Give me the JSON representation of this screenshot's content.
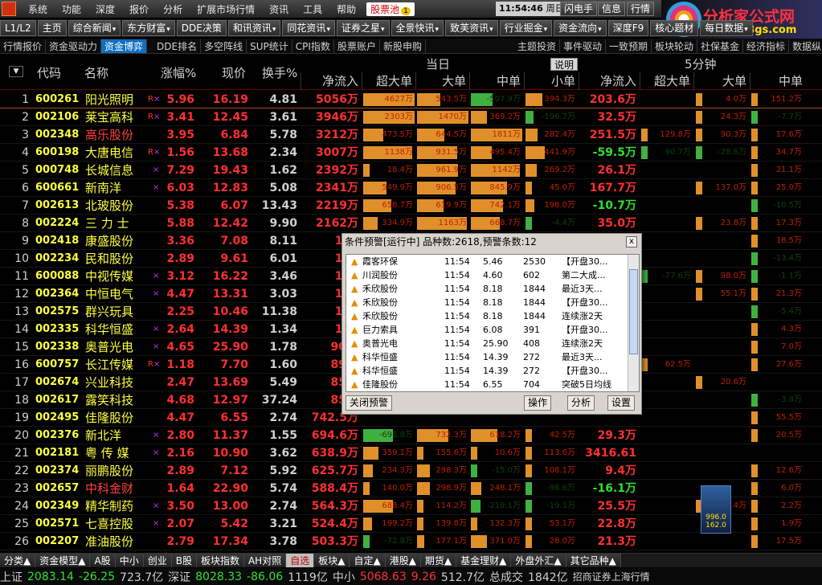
{
  "menu": [
    "系统",
    "功能",
    "深度",
    "报价",
    "分析",
    "扩展市场行情",
    "资讯",
    "工具",
    "帮助"
  ],
  "hot_menu": {
    "label": "股票池",
    "badge": "1"
  },
  "clock": {
    "time": "11:54:46",
    "day": "周日"
  },
  "top_buttons": [
    "闪电手",
    "信息",
    "行情"
  ],
  "logo": {
    "title": "分析家公式网",
    "url": "www.88gs.com"
  },
  "toolbar": [
    "L1/L2",
    "主页",
    "综合新闻",
    "东方财富",
    "DDE决策",
    "和讯资讯",
    "同花资讯",
    "证券之星",
    "全景快讯",
    "致芙资讯",
    "行业掘金",
    "资金流向",
    "深度F9",
    "核心题材",
    "每日数据"
  ],
  "tabs2": [
    "行情报价",
    "资金驱动力",
    "资金博弈",
    "DDE排名",
    "多空阵线",
    "SUP统计",
    "CPI指数",
    "股票账户",
    "新股申购"
  ],
  "tabs2_right": [
    "主题投资",
    "事件驱动",
    "一致预期",
    "板块轮动",
    "社保基金",
    "经济指标",
    "数据纵览"
  ],
  "header": {
    "code": "代码",
    "name": "名称",
    "chg": "涨幅%",
    "price": "现价",
    "turn": "换手%",
    "group_today": "当日",
    "group_5min": "5分钟",
    "explain": "说明",
    "sub": [
      "净流入",
      "超大单",
      "大单",
      "中单",
      "小单",
      "净流入",
      "超大单",
      "大单",
      "中单"
    ]
  },
  "rows": [
    {
      "idx": "1",
      "code": "600261",
      "name": "阳光照明",
      "rf": true,
      "chg": "5.96",
      "price": "16.19",
      "turn": "4.81",
      "net": "5056万",
      "b1": "4627万",
      "b2": "543.5万",
      "b3": "-507.9万",
      "b4": "394.3万",
      "n5": "203.6万",
      "c1": "",
      "c2": "4.0万",
      "c3": "151.2万"
    },
    {
      "idx": "2",
      "code": "002106",
      "name": "莱宝高科",
      "rf": true,
      "chg": "3.41",
      "price": "12.45",
      "turn": "3.61",
      "net": "3946万",
      "b1": "2303万",
      "b2": "1470万",
      "b3": "369.2万",
      "b4": "-196.7万",
      "n5": "32.5万",
      "c1": "",
      "c2": "24.3万",
      "c3": "-7.7万"
    },
    {
      "idx": "3",
      "code": "002348",
      "name": "高乐股份",
      "red": true,
      "rf": false,
      "chg": "3.95",
      "price": "6.84",
      "turn": "5.78",
      "net": "3212万",
      "b1": "473.5万",
      "b2": "644.5万",
      "b3": "1811万",
      "b4": "282.4万",
      "n5": "251.5万",
      "c1": "129.8万",
      "c2": "90.3万",
      "c3": "17.6万"
    },
    {
      "idx": "4",
      "code": "600198",
      "name": "大唐电信",
      "rf": true,
      "chg": "1.56",
      "price": "13.68",
      "turn": "2.34",
      "net": "3007万",
      "b1": "1138万",
      "b2": "931.5万",
      "b3": "495.4万",
      "b4": "441.9万",
      "n5": "-59.5万",
      "c1": "-90.7万",
      "c2": "-28.6万",
      "c3": "34.7万"
    },
    {
      "idx": "5",
      "code": "000748",
      "name": "长城信息",
      "x": true,
      "chg": "7.29",
      "price": "19.43",
      "turn": "1.62",
      "net": "2392万",
      "b1": "18.4万",
      "b2": "961.9万",
      "b3": "1142万",
      "b4": "269.2万",
      "n5": "26.1万",
      "c1": "",
      "c2": "",
      "c3": "21.1万"
    },
    {
      "idx": "6",
      "code": "600661",
      "name": "新南洋",
      "x": true,
      "chg": "6.03",
      "price": "12.83",
      "turn": "5.08",
      "net": "2341万",
      "b1": "549.9万",
      "b2": "906.5万",
      "b3": "845.9万",
      "b4": "45.0万",
      "n5": "167.7万",
      "c1": "",
      "c2": "137.0万",
      "c3": "25.0万"
    },
    {
      "idx": "7",
      "code": "002613",
      "name": "北玻股份",
      "chg": "5.38",
      "price": "6.07",
      "turn": "13.43",
      "net": "2219万",
      "b1": "658.7万",
      "b2": "619.9万",
      "b3": "742.1万",
      "b4": "198.0万",
      "n5": "-10.7万",
      "c1": "",
      "c2": "",
      "c3": "-10.5万"
    },
    {
      "idx": "8",
      "code": "002224",
      "name": "三 力 士",
      "chg": "5.88",
      "price": "12.42",
      "turn": "9.90",
      "net": "2162万",
      "b1": "334.9万",
      "b2": "1163万",
      "b3": "668.7万",
      "b4": "-4.4万",
      "n5": "35.0万",
      "c1": "",
      "c2": "23.8万",
      "c3": "17.3万"
    },
    {
      "idx": "9",
      "code": "002418",
      "name": "康盛股份",
      "chg": "3.36",
      "price": "7.08",
      "turn": "8.11",
      "net": "182",
      "c3": "18.5万"
    },
    {
      "idx": "10",
      "code": "002234",
      "name": "民和股份",
      "chg": "2.89",
      "price": "9.61",
      "turn": "6.01",
      "net": "169",
      "c3": "-13.4万"
    },
    {
      "idx": "11",
      "code": "600088",
      "name": "中视传媒",
      "x": true,
      "chg": "3.12",
      "price": "16.22",
      "turn": "3.46",
      "net": "168",
      "c1": "-77.6万",
      "c2": "98.0万",
      "c3": "-1.1万"
    },
    {
      "idx": "12",
      "code": "002364",
      "name": "中恒电气",
      "x": true,
      "chg": "4.47",
      "price": "13.31",
      "turn": "3.03",
      "net": "168",
      "c2": "55.1万",
      "c3": "21.3万"
    },
    {
      "idx": "13",
      "code": "002575",
      "name": "群兴玩具",
      "chg": "2.25",
      "price": "10.46",
      "turn": "11.38",
      "net": "149",
      "c3": "-5.4万"
    },
    {
      "idx": "14",
      "code": "002335",
      "name": "科华恒盛",
      "x": true,
      "chg": "2.64",
      "price": "14.39",
      "turn": "1.34",
      "net": "121",
      "c3": "4.3万"
    },
    {
      "idx": "15",
      "code": "002338",
      "name": "奥普光电",
      "x": true,
      "chg": "4.65",
      "price": "25.90",
      "turn": "1.78",
      "net": "907.",
      "c3": "7.0万"
    },
    {
      "idx": "16",
      "code": "600757",
      "name": "长江传媒",
      "rf": true,
      "chg": "1.18",
      "price": "7.70",
      "turn": "1.60",
      "net": "890.",
      "c1": "62.5万",
      "c3": "27.6万"
    },
    {
      "idx": "17",
      "code": "002674",
      "name": "兴业科技",
      "chg": "2.47",
      "price": "13.69",
      "turn": "5.49",
      "net": "852.",
      "c2": "20.6万"
    },
    {
      "idx": "18",
      "code": "002617",
      "name": "露笑科技",
      "chg": "4.68",
      "price": "12.97",
      "turn": "37.24",
      "net": "852.",
      "c3": "-3.8万"
    },
    {
      "idx": "19",
      "code": "002495",
      "name": "佳隆股份",
      "chg": "4.47",
      "price": "6.55",
      "turn": "2.74",
      "net": "742.5万",
      "c3": "55.5万"
    },
    {
      "idx": "20",
      "code": "002376",
      "name": "新北洋",
      "x": true,
      "chg": "2.80",
      "price": "11.37",
      "turn": "1.55",
      "net": "694.6万",
      "b1": "-698.8万",
      "b2": "732.3万",
      "b3": "618.2万",
      "b4": "42.5万",
      "n5": "29.3万",
      "c3": "20.5万"
    },
    {
      "idx": "21",
      "code": "002181",
      "name": "粤 传 媒",
      "x": true,
      "chg": "2.16",
      "price": "10.90",
      "turn": "3.62",
      "net": "638.9万",
      "b1": "359.1万",
      "b2": "155.6万",
      "b3": "10.6万",
      "b4": "113.6万",
      "n5": "3416.61"
    },
    {
      "idx": "22",
      "code": "002374",
      "name": "丽鹏股份",
      "chg": "2.89",
      "price": "7.12",
      "turn": "5.92",
      "net": "625.7万",
      "b1": "234.3万",
      "b2": "298.3万",
      "b3": "-15.0万",
      "b4": "108.1万",
      "n5": "9.4万",
      "c3": "12.6万"
    },
    {
      "idx": "23",
      "code": "002657",
      "name": "中科金财",
      "red": true,
      "chg": "1.64",
      "price": "22.90",
      "turn": "5.74",
      "net": "588.4万",
      "b1": "140.0万",
      "b2": "298.9万",
      "b3": "248.1万",
      "b4": "-98.6万",
      "n5": "-16.1万",
      "c3": "6.0万"
    },
    {
      "idx": "24",
      "code": "002349",
      "name": "精华制药",
      "x": true,
      "chg": "3.50",
      "price": "13.00",
      "turn": "2.74",
      "net": "564.3万",
      "b1": "688.4万",
      "b2": "114.2万",
      "b3": "-219.1万",
      "b4": "-19.1万",
      "n5": "25.5万",
      "c2": "4.4万",
      "c3": "2.2万"
    },
    {
      "idx": "25",
      "code": "002571",
      "name": "七喜控股",
      "x": true,
      "chg": "2.07",
      "price": "5.42",
      "turn": "3.21",
      "net": "524.4万",
      "b1": "199.2万",
      "b2": "139.8万",
      "b3": "132.3万",
      "b4": "53.1万",
      "n5": "22.8万",
      "c3": "1.9万"
    },
    {
      "idx": "26",
      "code": "002207",
      "name": "准油股份",
      "chg": "2.79",
      "price": "17.34",
      "turn": "3.78",
      "net": "503.3万",
      "b1": "-72.8万",
      "b2": "177.1万",
      "b3": "371.0万",
      "b4": "28.0万",
      "n5": "21.3万",
      "c3": "17.5万"
    }
  ],
  "popup": {
    "title": "条件预警[运行中] 品种数:2618,预警条数:12",
    "close": "x",
    "items": [
      {
        "n": "霞客环保",
        "t": "11:54",
        "p": "5.46",
        "v": "2530",
        "m": "【开盘30..."
      },
      {
        "n": "川润股份",
        "t": "11:54",
        "p": "4.60",
        "v": "602",
        "m": "第二大成..."
      },
      {
        "n": "禾欣股份",
        "t": "11:54",
        "p": "8.18",
        "v": "1844",
        "m": "最近3天..."
      },
      {
        "n": "禾欣股份",
        "t": "11:54",
        "p": "8.18",
        "v": "1844",
        "m": "【开盘30..."
      },
      {
        "n": "禾欣股份",
        "t": "11:54",
        "p": "8.18",
        "v": "1844",
        "m": "连续涨2天"
      },
      {
        "n": "巨力索具",
        "t": "11:54",
        "p": "6.08",
        "v": "391",
        "m": "【开盘30..."
      },
      {
        "n": "奥普光电",
        "t": "11:54",
        "p": "25.90",
        "v": "408",
        "m": "连续涨2天"
      },
      {
        "n": "科华恒盛",
        "t": "11:54",
        "p": "14.39",
        "v": "272",
        "m": "最近3天..."
      },
      {
        "n": "科华恒盛",
        "t": "11:54",
        "p": "14.39",
        "v": "272",
        "m": "【开盘30..."
      },
      {
        "n": "佳隆股份",
        "t": "11:54",
        "p": "6.55",
        "v": "704",
        "m": "突破5日均线"
      }
    ],
    "buttons": {
      "close_alert": "关闭预警",
      "ops": "操作",
      "analyze": "分析",
      "settings": "设置"
    }
  },
  "bottom_tabs": [
    "分类▲",
    "资金模型▲",
    "A股",
    "中小",
    "创业",
    "B股",
    "板块指数",
    "AH对照",
    "自选",
    "板块▲",
    "自定▲",
    "港股▲",
    "期货▲",
    "基金理财▲",
    "外盘外汇▲",
    "其它品种▲"
  ],
  "status": {
    "sh_label": "上证",
    "sh_val": "2083.14",
    "sh_chg": "-26.25",
    "sh_amt": "723.7亿",
    "sz_label": "深证",
    "sz_val": "8028.33",
    "sz_chg": "-86.06",
    "sz_amt": "1119亿",
    "zx_label": "中小",
    "zx_val": "5068.63",
    "zx_chg": "9.26",
    "zx_amt": "512.7亿",
    "total_label": "总成交",
    "total_amt": "1842亿",
    "broker": "招商证券上海行情"
  },
  "widget": {
    "v1": "996.0",
    "v2": "162.0"
  }
}
